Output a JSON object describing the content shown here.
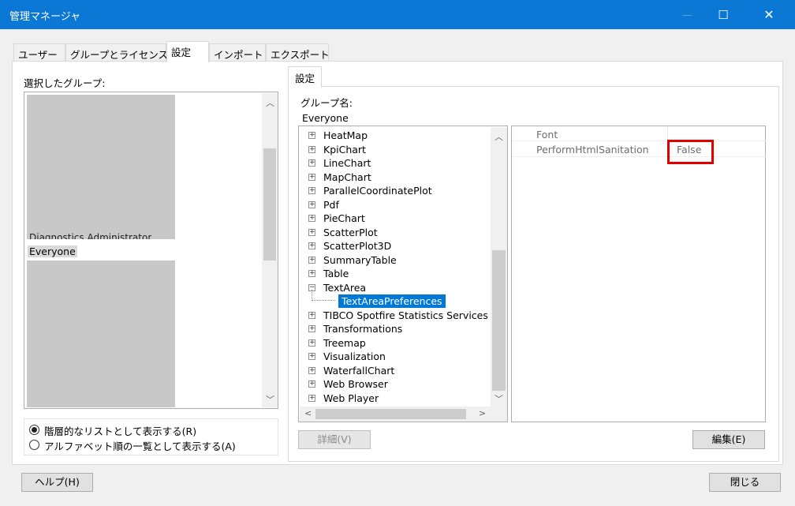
{
  "window": {
    "title": "管理マネージャ",
    "minimize_glyph": "—",
    "maximize_glyph": "☐",
    "close_glyph": "✕"
  },
  "tabs": [
    {
      "label": "ユーザー"
    },
    {
      "label": "グループとライセンス"
    },
    {
      "label": "設定",
      "active": true
    },
    {
      "label": "インポート"
    },
    {
      "label": "エクスポート"
    }
  ],
  "groups": {
    "label": "選択したグループ:",
    "partial_item": "Diagnostics Administrator",
    "selected_item": "Everyone",
    "display_options": [
      {
        "label": "階層的なリストとして表示する(R)",
        "selected": true
      },
      {
        "label": "アルファベット順の一覧として表示する(A)",
        "selected": false
      }
    ]
  },
  "settings": {
    "tab_label": "設定",
    "group_name_label": "グループ名:",
    "group_name_value": "Everyone",
    "tree_items": [
      {
        "label": "HeatMap",
        "expander": "+"
      },
      {
        "label": "KpiChart",
        "expander": "+"
      },
      {
        "label": "LineChart",
        "expander": "+"
      },
      {
        "label": "MapChart",
        "expander": "+"
      },
      {
        "label": "ParallelCoordinatePlot",
        "expander": "+"
      },
      {
        "label": "Pdf",
        "expander": "+"
      },
      {
        "label": "PieChart",
        "expander": "+"
      },
      {
        "label": "ScatterPlot",
        "expander": "+"
      },
      {
        "label": "ScatterPlot3D",
        "expander": "+"
      },
      {
        "label": "SummaryTable",
        "expander": "+"
      },
      {
        "label": "Table",
        "expander": "+"
      },
      {
        "label": "TextArea",
        "expander": "−"
      },
      {
        "label": "TextAreaPreferences",
        "expander": "",
        "selected": true,
        "child": true
      },
      {
        "label": "TIBCO Spotfire Statistics Services",
        "expander": "+"
      },
      {
        "label": "Transformations",
        "expander": "+"
      },
      {
        "label": "Treemap",
        "expander": "+"
      },
      {
        "label": "Visualization",
        "expander": "+"
      },
      {
        "label": "WaterfallChart",
        "expander": "+"
      },
      {
        "label": "Web Browser",
        "expander": "+"
      },
      {
        "label": "Web Player",
        "expander": "+"
      }
    ],
    "properties": [
      {
        "name": "Font",
        "value": ""
      },
      {
        "name": "PerformHtmlSanitation",
        "value": "False"
      }
    ],
    "details_button": "詳細(V)",
    "edit_button": "編集(E)"
  },
  "footer": {
    "help_button": "ヘルプ(H)",
    "close_button": "閉じる"
  }
}
